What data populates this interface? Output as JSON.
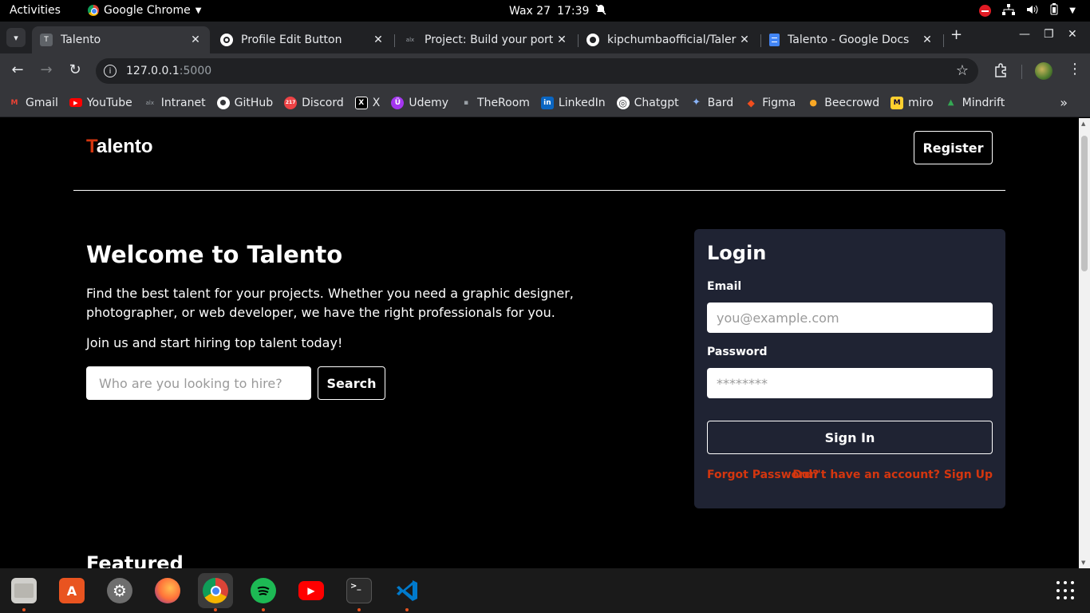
{
  "system_bar": {
    "activities": "Activities",
    "app_name": "Google Chrome",
    "date": "Wax 27",
    "time": "17:39"
  },
  "browser": {
    "tabs": [
      {
        "title": "Talento",
        "favicon": "T",
        "favicon_color": "#5f6368"
      },
      {
        "title": "Profile Edit Button",
        "favicon": "G",
        "favicon_color": "#ffffff"
      },
      {
        "title": "Project: Build your port",
        "favicon": "alx",
        "favicon_color": "#202124"
      },
      {
        "title": "kipchumbaofficial/Taler",
        "favicon": "github-icon",
        "favicon_color": "#202124"
      },
      {
        "title": "Talento - Google Docs",
        "favicon": "docs-icon",
        "favicon_color": "#4285f4"
      }
    ],
    "url_host": "127.0.0.1",
    "url_port": ":5000",
    "bookmarks": [
      {
        "label": "Gmail",
        "icon": "M",
        "color": "#ea4335"
      },
      {
        "label": "YouTube",
        "icon": "▶",
        "color": "#ff0000"
      },
      {
        "label": "Intranet",
        "icon": "alx",
        "color": "#35363a"
      },
      {
        "label": "GitHub",
        "icon": "●",
        "color": "#35363a"
      },
      {
        "label": "Discord",
        "icon": "217",
        "color": "#ed4245"
      },
      {
        "label": "X",
        "icon": "X",
        "color": "#000000"
      },
      {
        "label": "Udemy",
        "icon": "Ü",
        "color": "#a435f0"
      },
      {
        "label": "TheRoom",
        "icon": "▪",
        "color": "#35363a"
      },
      {
        "label": "LinkedIn",
        "icon": "in",
        "color": "#0a66c2"
      },
      {
        "label": "Chatgpt",
        "icon": "◎",
        "color": "#35363a"
      },
      {
        "label": "Bard",
        "icon": "✦",
        "color": "#35363a"
      },
      {
        "label": "Figma",
        "icon": "◆",
        "color": "#f24e1e"
      },
      {
        "label": "Beecrowd",
        "icon": "●",
        "color": "#35363a"
      },
      {
        "label": "miro",
        "icon": "M",
        "color": "#ffd02f"
      },
      {
        "label": "Mindrift",
        "icon": "▲",
        "color": "#35363a"
      }
    ]
  },
  "site": {
    "logo_first": "T",
    "logo_rest": "alento",
    "register_label": "Register",
    "welcome_title": "Welcome to Talento",
    "description": "Find the best talent for your projects. Whether you need a graphic designer, photographer, or web developer, we have the right professionals for you.",
    "join_text": "Join us and start hiring top talent today!",
    "search_placeholder": "Who are you looking to hire?",
    "search_label": "Search",
    "featured_title": "Featured"
  },
  "login": {
    "title": "Login",
    "email_label": "Email",
    "email_placeholder": "you@example.com",
    "password_label": "Password",
    "password_placeholder": "********",
    "signin_label": "Sign In",
    "forgot_label": "Forgot Password?",
    "signup_label": "Don't have an account? Sign Up"
  },
  "dock": [
    {
      "name": "files",
      "color": "#d0cfcb"
    },
    {
      "name": "app-center",
      "color": "#e95420"
    },
    {
      "name": "settings",
      "color": "#6e6e6e"
    },
    {
      "name": "firefox",
      "color": "#ff7139"
    },
    {
      "name": "chrome",
      "color": "#4285f4"
    },
    {
      "name": "spotify",
      "color": "#1db954"
    },
    {
      "name": "youtube",
      "color": "#ff0000"
    },
    {
      "name": "terminal",
      "color": "#2c2c2c"
    },
    {
      "name": "vscode",
      "color": "#007acc"
    }
  ]
}
